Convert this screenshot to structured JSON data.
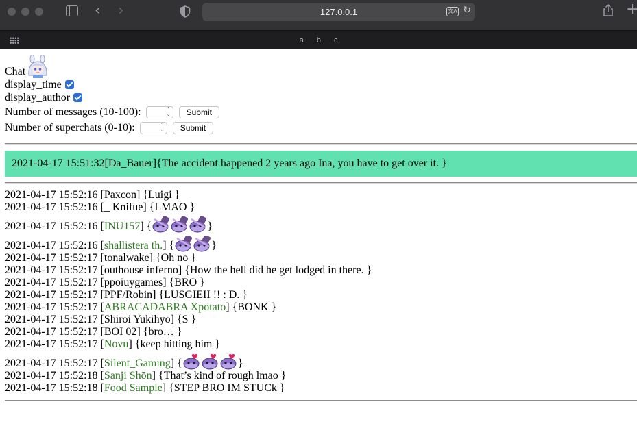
{
  "browser": {
    "url": "127.0.0.1",
    "bookmarks": [
      "a",
      "b",
      "c"
    ]
  },
  "page": {
    "title": "Chat",
    "options": [
      {
        "label": "display_time",
        "checked": true
      },
      {
        "label": "display_author",
        "checked": true
      }
    ],
    "messages_input": {
      "label": "Number of messages (10-100):",
      "value": "",
      "button": "Submit"
    },
    "superchats_input": {
      "label": "Number of superchats (0-10):",
      "value": "",
      "button": "Submit"
    }
  },
  "superchat": {
    "text": "2021-04-17 15:51:32[Da_Bauer]{The accident happened 2 years ago Ina, you have to get over it. }",
    "color": "#62e1b0"
  },
  "colors": {
    "member_author": "#2c7a1f"
  },
  "messages": [
    {
      "time": "2021-04-17 15:52:16",
      "author": "Paxcon",
      "member": false,
      "text": "Luigi ",
      "emotes": 0
    },
    {
      "time": "2021-04-17 15:52:16",
      "author": "_ Knifue",
      "member": false,
      "text": "LMAO ",
      "emotes": 0
    },
    {
      "time": "2021-04-17 15:52:16",
      "author": "INU157",
      "member": true,
      "text": "",
      "emotes": 3,
      "emote_icon": "tako-bonk-icon"
    },
    {
      "time": "2021-04-17 15:52:16",
      "author": "shallistera th.",
      "member": true,
      "text": "",
      "emotes": 2,
      "emote_icon": "tako-bonk-icon"
    },
    {
      "time": "2021-04-17 15:52:17",
      "author": "tonalwake",
      "member": false,
      "text": "Oh no ",
      "emotes": 0
    },
    {
      "time": "2021-04-17 15:52:17",
      "author": "outhouse inferno",
      "member": false,
      "text": "How the hell did he get lodged in there. ",
      "emotes": 0
    },
    {
      "time": "2021-04-17 15:52:17",
      "author": "ppoiuygames",
      "member": false,
      "text": "BRO ",
      "emotes": 0
    },
    {
      "time": "2021-04-17 15:52:17",
      "author": "PPF/Robin",
      "member": false,
      "text": "LUSGIEII !! : D. ",
      "emotes": 0
    },
    {
      "time": "2021-04-17 15:52:17",
      "author": "ABRACADABRA Xpotato",
      "member": true,
      "text": "BONK ",
      "emotes": 0
    },
    {
      "time": "2021-04-17 15:52:17",
      "author": "Shiroi Yukihyo",
      "member": false,
      "text": "S ",
      "emotes": 0
    },
    {
      "time": "2021-04-17 15:52:17",
      "author": "BOI 02",
      "member": false,
      "text": "bro… ",
      "emotes": 0
    },
    {
      "time": "2021-04-17 15:52:17",
      "author": "Novu",
      "member": true,
      "text": "keep hitting him ",
      "emotes": 0
    },
    {
      "time": "2021-04-17 15:52:17",
      "author": "Silent_Gaming",
      "member": true,
      "text": "",
      "emotes": 3,
      "emote_icon": "tako-heart-icon"
    },
    {
      "time": "2021-04-17 15:52:18",
      "author": "Sanji Shōn",
      "member": true,
      "text": "That’s kind of rough lmao ",
      "emotes": 0
    },
    {
      "time": "2021-04-17 15:52:18",
      "author": "Food Sample",
      "member": true,
      "text": "STEP BRO IM STUCk ",
      "emotes": 0
    }
  ]
}
